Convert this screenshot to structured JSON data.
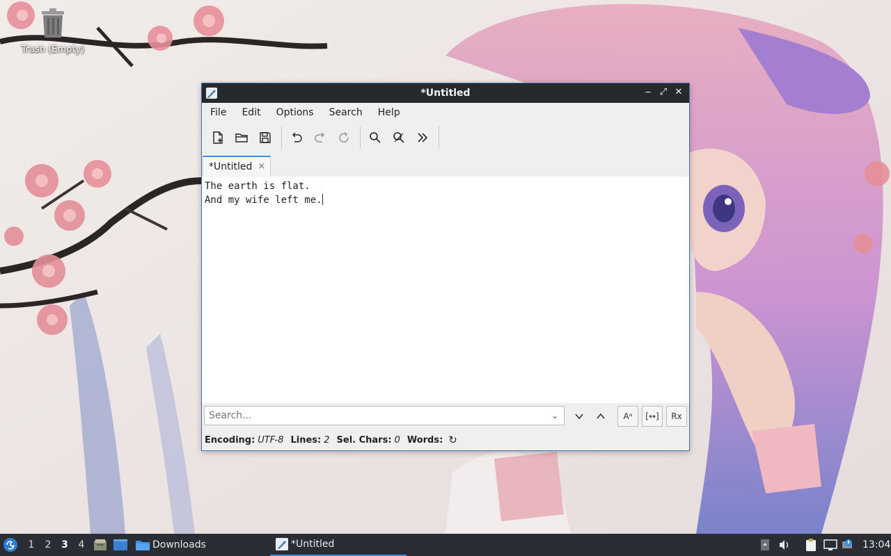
{
  "desktop": {
    "trash_label": "Trash (Empty)"
  },
  "window": {
    "title": "*Untitled",
    "controls": [
      "minimize-icon",
      "maximize-icon",
      "close-icon"
    ]
  },
  "menubar": [
    "File",
    "Edit",
    "Options",
    "Search",
    "Help"
  ],
  "toolbar": {
    "buttons": [
      "new-file-icon",
      "open-folder-icon",
      "save-icon",
      "undo-icon",
      "redo-icon",
      "reload-icon",
      "find-icon",
      "find-replace-icon",
      "more-icon"
    ]
  },
  "tabs": [
    {
      "label": "*Untitled",
      "close": "×"
    }
  ],
  "editor": {
    "lines": [
      "The earth is flat.",
      "And my wife left me."
    ]
  },
  "search": {
    "placeholder": "Search...",
    "toggle_case": "Aᵃ",
    "toggle_whole": "[↔]",
    "toggle_regex": "Rx"
  },
  "status": {
    "encoding_label": "Encoding:",
    "encoding_value": "UTF-8",
    "lines_label": "Lines:",
    "lines_value": "2",
    "sel_label": "Sel. Chars:",
    "sel_value": "0",
    "words_label": "Words:"
  },
  "taskbar": {
    "workspaces": [
      "1",
      "2",
      "3",
      "4"
    ],
    "active_workspace": "3",
    "downloads_label": "Downloads",
    "task_label": "*Untitled",
    "clock": "13:04"
  },
  "colors": {
    "accent": "#3a8ee6",
    "titlebar": "#26292e",
    "taskbar": "#2a2d33"
  }
}
